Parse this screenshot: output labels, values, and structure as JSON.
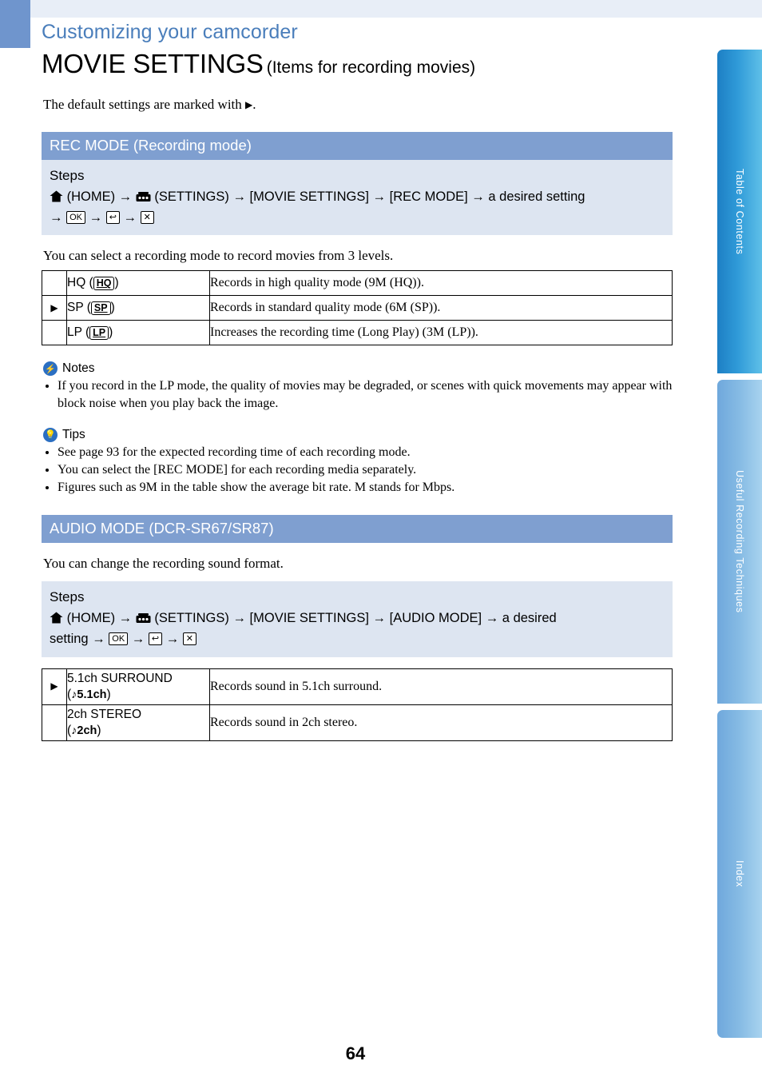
{
  "header": {
    "kicker": "Customizing your camcorder",
    "title_main": "MOVIE SETTINGS",
    "title_sub": "(Items for recording movies)",
    "lead_prefix": "The default settings are marked with ",
    "lead_suffix": "."
  },
  "side_tabs": [
    {
      "label": "Table of Contents"
    },
    {
      "label": "Useful Recording Techniques"
    },
    {
      "label": "Index"
    }
  ],
  "sections": [
    {
      "bar": "REC MODE (Recording mode)",
      "steps_title": "Steps",
      "steps_line1_a": "(HOME) →",
      "steps_line1_b": "(SETTINGS) → [MOVIE SETTINGS] → [REC MODE] → a desired setting",
      "steps_keys": [
        "OK",
        "↩",
        "✕"
      ],
      "intro": "You can select a recording mode to record movies from 3 levels.",
      "rows": [
        {
          "marker": "",
          "name": "HQ (",
          "badge": "HQ",
          "name_tail": ")",
          "desc": "Records in high quality mode (9M (HQ))."
        },
        {
          "marker": "▶",
          "name": "SP (",
          "badge": "SP",
          "name_tail": ")",
          "desc": "Records in standard quality mode (6M (SP))."
        },
        {
          "marker": "",
          "name": "LP (",
          "badge": "LP",
          "name_tail": ")",
          "desc": "Increases the recording time (Long Play) (3M (LP))."
        }
      ]
    }
  ],
  "notes": {
    "label": "Notes",
    "items": [
      "If you record in the LP mode, the quality of movies may be degraded, or scenes with quick movements may appear with block noise when you play back the image."
    ]
  },
  "tips": {
    "label": "Tips",
    "items": [
      "See page 93 for the expected recording time of each recording mode.",
      "You can select the [REC MODE] for each recording media separately.",
      "Figures such as 9M in the table show the average bit rate. M stands for Mbps."
    ]
  },
  "audio": {
    "bar": "AUDIO MODE (DCR-SR67/SR87)",
    "intro": "You can change the recording sound format.",
    "steps_title": "Steps",
    "steps_line1_a": "(HOME) →",
    "steps_line1_b": "(SETTINGS) → [MOVIE SETTINGS] → [AUDIO MODE] → a desired",
    "steps_line2": "setting →",
    "steps_keys": [
      "OK",
      "↩",
      "✕"
    ],
    "rows": [
      {
        "marker": "▶",
        "name": "5.1ch SURROUND",
        "badge": "♪5.1ch",
        "desc": "Records sound in 5.1ch surround."
      },
      {
        "marker": "",
        "name": "2ch STEREO",
        "badge": "♪2ch",
        "desc": "Records sound in 2ch stereo."
      }
    ]
  },
  "footer": {
    "page_number": "64"
  }
}
